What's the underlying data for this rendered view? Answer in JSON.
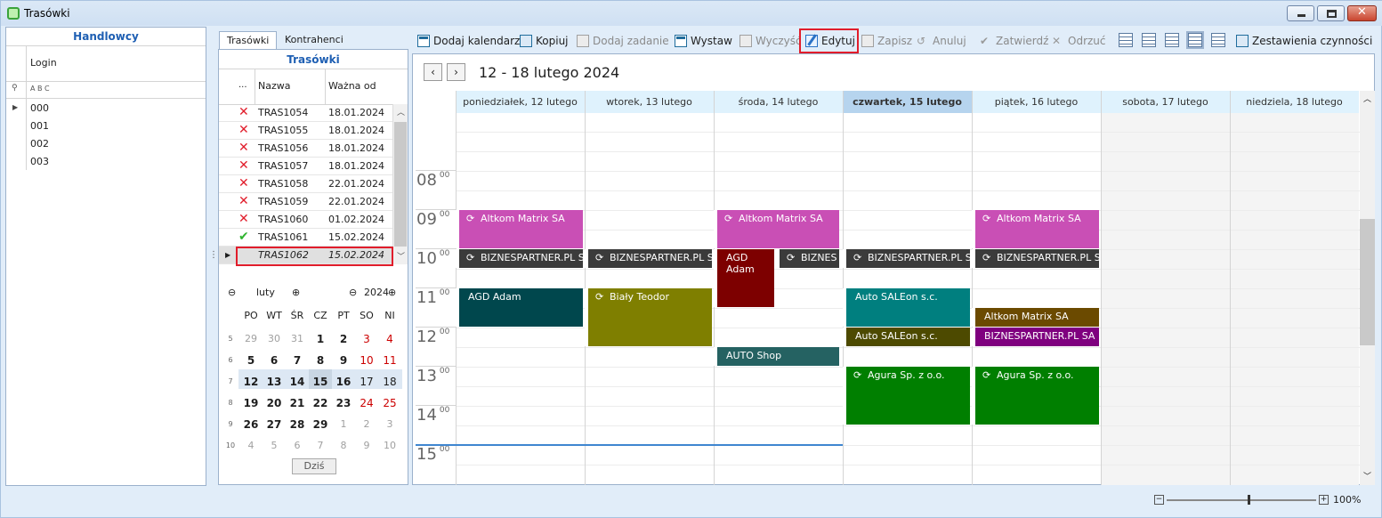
{
  "window": {
    "title": "Trasówki"
  },
  "left_panel": {
    "title": "Handlowcy",
    "column": "Login",
    "filter_hint": "A B C",
    "rows": [
      "000",
      "001",
      "002",
      "003"
    ]
  },
  "middle_panel": {
    "tabs": [
      "Trasówki",
      "Kontrahenci"
    ],
    "title": "Trasówki",
    "columns": [
      "...",
      "Nazwa",
      "Ważna od"
    ],
    "rows": [
      {
        "icon": "red-x-icon",
        "name": "TRAS1054",
        "date": "18.01.2024"
      },
      {
        "icon": "red-x-icon",
        "name": "TRAS1055",
        "date": "18.01.2024"
      },
      {
        "icon": "red-x-icon",
        "name": "TRAS1056",
        "date": "18.01.2024"
      },
      {
        "icon": "red-x-icon",
        "name": "TRAS1057",
        "date": "18.01.2024"
      },
      {
        "icon": "red-x-icon",
        "name": "TRAS1058",
        "date": "22.01.2024"
      },
      {
        "icon": "red-x-icon",
        "name": "TRAS1059",
        "date": "22.01.2024"
      },
      {
        "icon": "red-x-icon",
        "name": "TRAS1060",
        "date": "01.02.2024"
      },
      {
        "icon": "green-check-icon",
        "name": "TRAS1061",
        "date": "15.02.2024"
      },
      {
        "icon": "",
        "name": "TRAS1062",
        "date": "15.02.2024"
      }
    ]
  },
  "mini_calendar": {
    "month": "luty",
    "year": "2024",
    "days": [
      "PO",
      "WT",
      "ŚR",
      "CZ",
      "PT",
      "SO",
      "NI"
    ],
    "weeks": [
      {
        "wk": "5",
        "d": [
          "29",
          "30",
          "31",
          "1",
          "2",
          "3",
          "4"
        ]
      },
      {
        "wk": "6",
        "d": [
          "5",
          "6",
          "7",
          "8",
          "9",
          "10",
          "11"
        ]
      },
      {
        "wk": "7",
        "d": [
          "12",
          "13",
          "14",
          "15",
          "16",
          "17",
          "18"
        ]
      },
      {
        "wk": "8",
        "d": [
          "19",
          "20",
          "21",
          "22",
          "23",
          "24",
          "25"
        ]
      },
      {
        "wk": "9",
        "d": [
          "26",
          "27",
          "28",
          "29",
          "1",
          "2",
          "3"
        ]
      },
      {
        "wk": "10",
        "d": [
          "4",
          "5",
          "6",
          "7",
          "8",
          "9",
          "10"
        ]
      }
    ],
    "today_button": "Dziś"
  },
  "toolbar": {
    "add_calendar": "Dodaj kalendarz",
    "copy": "Kopiuj",
    "add_task": "Dodaj zadanie",
    "issue": "Wystaw",
    "clear": "Wyczyść",
    "edit": "Edytuj",
    "save": "Zapisz",
    "cancel": "Anuluj",
    "approve": "Zatwierdź",
    "reject": "Odrzuć",
    "summary": "Zestawienia czynności"
  },
  "scheduler": {
    "range": "12 - 18 lutego 2024",
    "days": [
      "poniedziałek, 12 lutego",
      "wtorek, 13 lutego",
      "środa, 14 lutego",
      "czwartek, 15 lutego",
      "piątek, 16 lutego",
      "sobota, 17 lutego",
      "niedziela, 18 lutego"
    ],
    "hours": [
      "08",
      "09",
      "10",
      "11",
      "12",
      "13",
      "14",
      "15"
    ],
    "minutes": "00",
    "appointments": [
      {
        "text": "Altkom Matrix SA",
        "color": "#c94fb5"
      },
      {
        "text": "BIZNESPARTNER.PL S",
        "color": "#3b3b3b"
      },
      {
        "text": "AGD Adam",
        "color": "#00474d"
      },
      {
        "text": "BIZNESPARTNER.PL S",
        "color": "#3b3b3b"
      },
      {
        "text": "Biały Teodor",
        "color": "#7f7f00"
      },
      {
        "text": "Altkom Matrix SA",
        "color": "#c94fb5"
      },
      {
        "text": "AGD Adam",
        "color": "#7d0000"
      },
      {
        "text": "BIZNES",
        "color": "#3b3b3b"
      },
      {
        "text": "AUTO Shop",
        "color": "#256262"
      },
      {
        "text": "BIZNESPARTNER.PL S",
        "color": "#3b3b3b"
      },
      {
        "text": "Auto SALEon s.c.",
        "color": "#007f7f"
      },
      {
        "text": "Auto SALEon s.c.",
        "color": "#4d4a00"
      },
      {
        "text": "Agura Sp. z o.o.",
        "color": "#007f00"
      },
      {
        "text": "Altkom Matrix SA",
        "color": "#c94fb5"
      },
      {
        "text": "BIZNESPARTNER.PL S",
        "color": "#3b3b3b"
      },
      {
        "text": "Altkom Matrix SA",
        "color": "#6b4a00"
      },
      {
        "text": "BIZNESPARTNER.PL SA",
        "color": "#7f007f"
      },
      {
        "text": "Agura Sp. z o.o.",
        "color": "#007f00"
      }
    ]
  },
  "zoom": {
    "value": "100%",
    "level": 0.5
  }
}
